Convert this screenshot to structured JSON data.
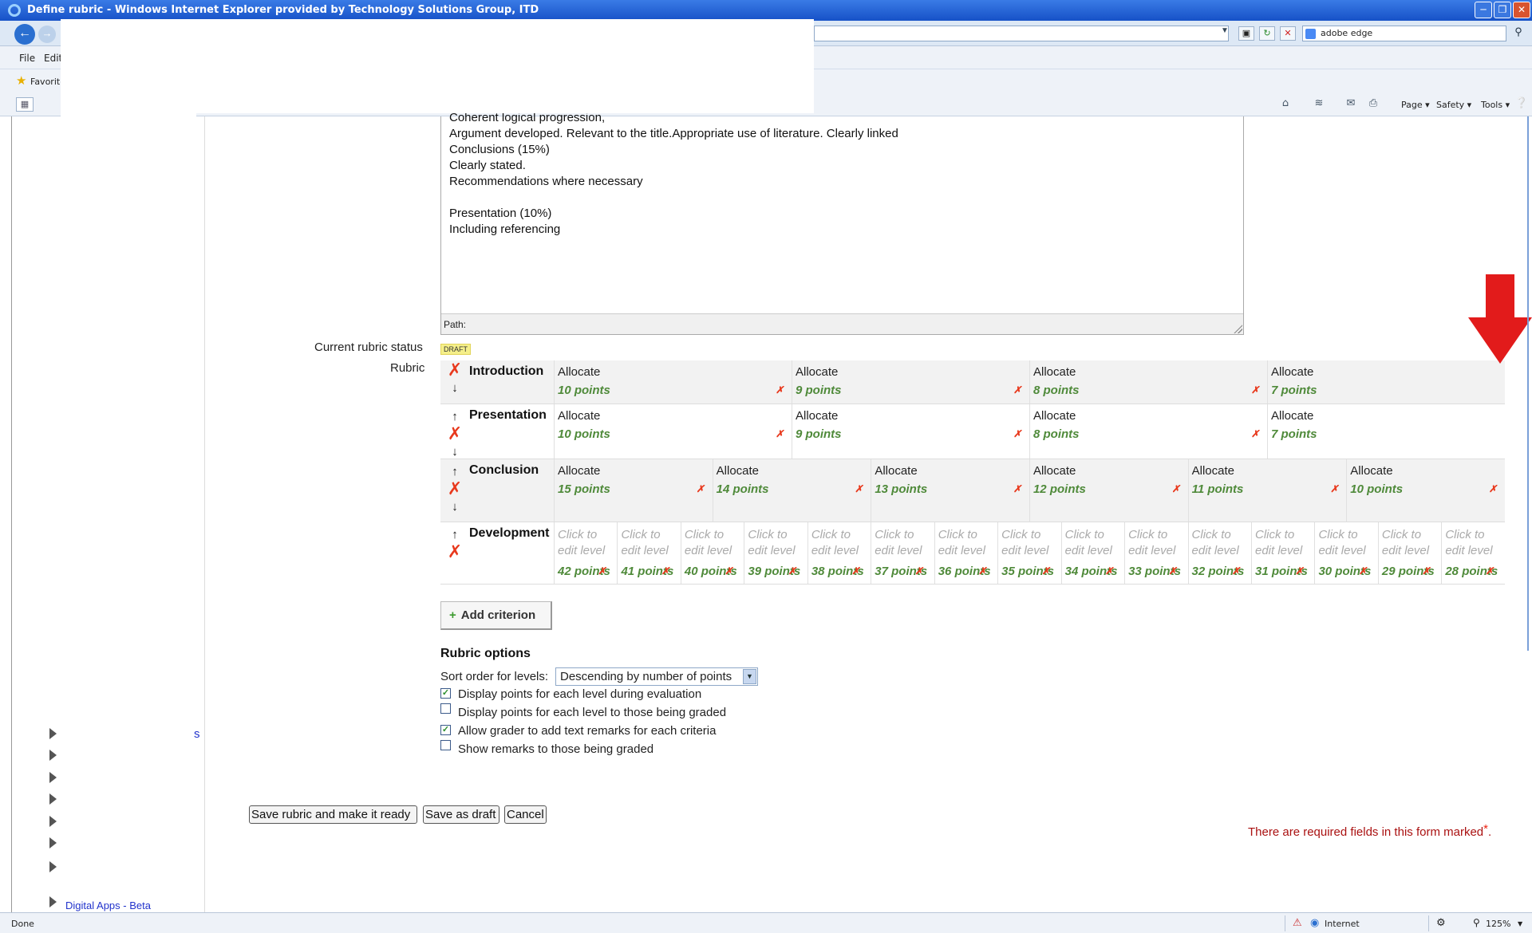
{
  "window": {
    "title": "Define rubric - Windows Internet Explorer provided by Technology Solutions Group, ITD"
  },
  "browser": {
    "search_value": "adobe edge",
    "menu": {
      "file": "File",
      "edit": "Edit"
    },
    "favorites_label": "Favorites",
    "commands": {
      "page": "Page ▾",
      "safety": "Safety ▾",
      "tools": "Tools ▾"
    }
  },
  "editor": {
    "lines": [
      "Coherent logical progression,",
      "Argument developed. Relevant to the title.Appropriate use of literature. Clearly linked",
      "Conclusions (15%)",
      "Clearly stated.",
      "Recommendations where necessary",
      "",
      "Presentation (10%)",
      "Including referencing"
    ],
    "path_label": "Path:"
  },
  "form": {
    "status_label": "Current rubric status",
    "status_value": "DRAFT",
    "rubric_label": "Rubric"
  },
  "rubric": {
    "criteria": [
      {
        "name": "Introduction",
        "levels": [
          {
            "definition": "Allocate",
            "points": "10 points"
          },
          {
            "definition": "Allocate",
            "points": "9 points"
          },
          {
            "definition": "Allocate",
            "points": "8 points"
          },
          {
            "definition": "Allocate",
            "points": "7 points"
          }
        ]
      },
      {
        "name": "Presentation",
        "levels": [
          {
            "definition": "Allocate",
            "points": "10 points"
          },
          {
            "definition": "Allocate",
            "points": "9 points"
          },
          {
            "definition": "Allocate",
            "points": "8 points"
          },
          {
            "definition": "Allocate",
            "points": "7 points"
          }
        ]
      },
      {
        "name": "Conclusion",
        "levels": [
          {
            "definition": "Allocate",
            "points": "15 points"
          },
          {
            "definition": "Allocate",
            "points": "14 points"
          },
          {
            "definition": "Allocate",
            "points": "13 points"
          },
          {
            "definition": "Allocate",
            "points": "12 points"
          },
          {
            "definition": "Allocate",
            "points": "11 points"
          },
          {
            "definition": "Allocate",
            "points": "10 points"
          }
        ]
      },
      {
        "name": "Development",
        "placeholder": "Click to edit level",
        "levels": [
          {
            "points": "42 points"
          },
          {
            "points": "41 points"
          },
          {
            "points": "40 points"
          },
          {
            "points": "39 points"
          },
          {
            "points": "38 points"
          },
          {
            "points": "37 points"
          },
          {
            "points": "36 points"
          },
          {
            "points": "35 points"
          },
          {
            "points": "34 points"
          },
          {
            "points": "33 points"
          },
          {
            "points": "32 points"
          },
          {
            "points": "31 points"
          },
          {
            "points": "30 points"
          },
          {
            "points": "29 points"
          },
          {
            "points": "28 points"
          }
        ]
      }
    ],
    "add_criterion_label": "Add criterion"
  },
  "options": {
    "title": "Rubric options",
    "sort_label": "Sort order for levels:",
    "sort_value": "Descending by number of points",
    "checkboxes": [
      {
        "label": "Display points for each level during evaluation",
        "checked": true
      },
      {
        "label": "Display points for each level to those being graded",
        "checked": false
      },
      {
        "label": "Allow grader to add text remarks for each criteria",
        "checked": true
      },
      {
        "label": "Show remarks to those being graded",
        "checked": false
      }
    ]
  },
  "buttons": {
    "save_ready": "Save rubric and make it ready",
    "save_draft": "Save as draft",
    "cancel": "Cancel"
  },
  "required_note": "There are required fields in this form marked",
  "sidebar": {
    "link_fragment": "s",
    "cut_link": "Digital Apps - Beta"
  },
  "statusbar": {
    "done": "Done",
    "zone": "Internet",
    "zoom": "125%"
  },
  "colors": {
    "points_green": "#4f8a3a",
    "delete_red": "#e8391d",
    "annotation_arrow": "#e21b1b"
  }
}
